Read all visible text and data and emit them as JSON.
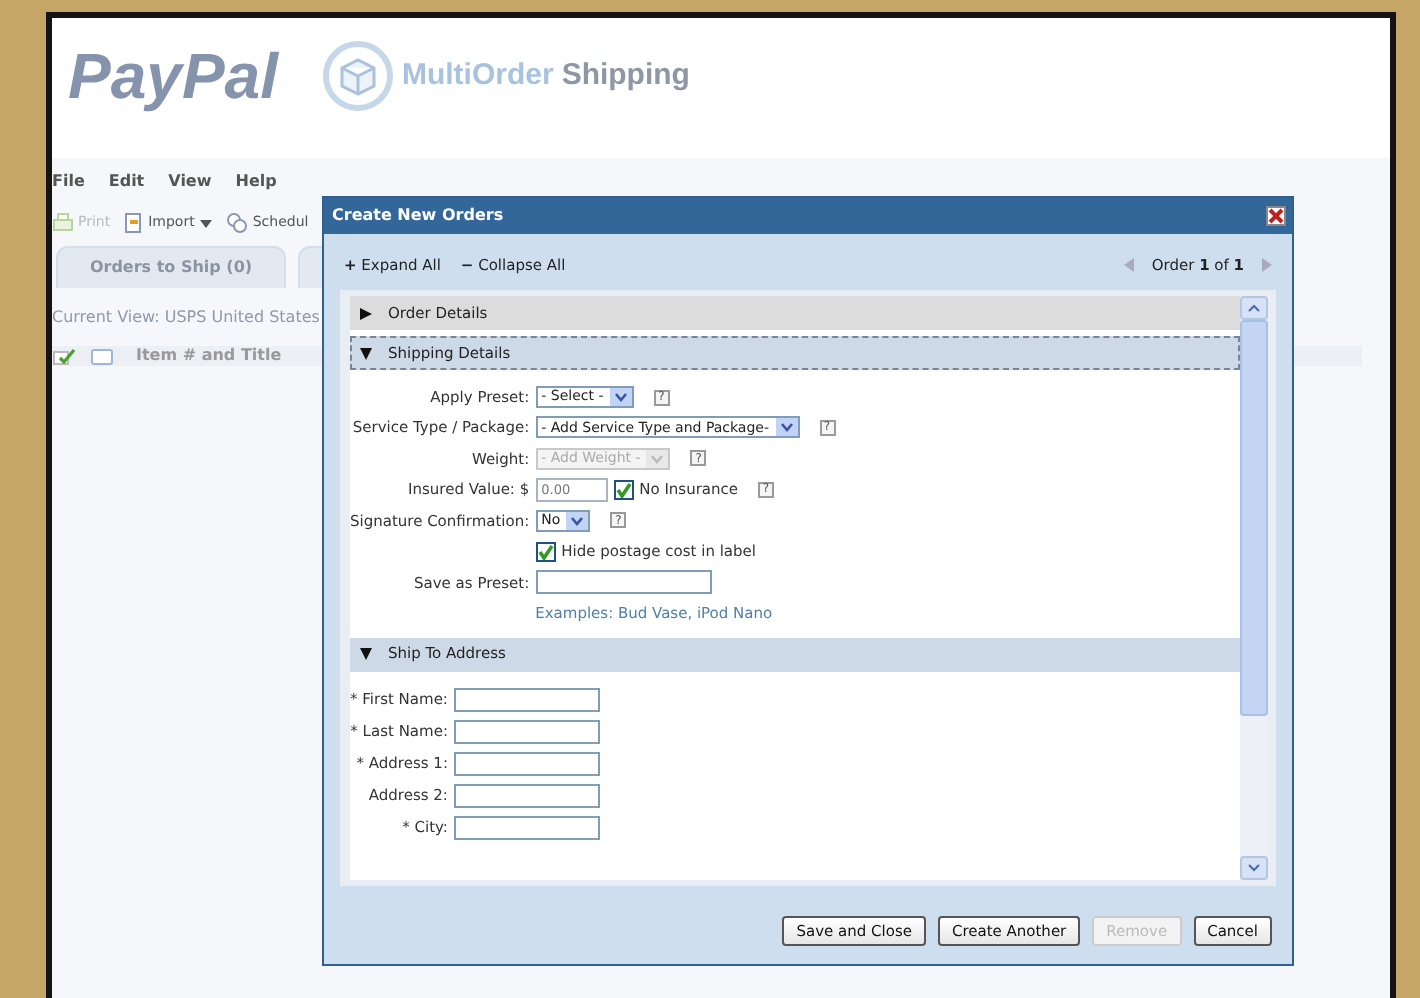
{
  "header": {
    "brand": "PayPal",
    "product_first": "MultiOrder",
    "product_second": "Shipping"
  },
  "menu": [
    "File",
    "Edit",
    "View",
    "Help"
  ],
  "toolbar": [
    {
      "kind": "print",
      "label": "Print",
      "disabled": true,
      "dropdown": false
    },
    {
      "kind": "import",
      "label": "Import",
      "disabled": false,
      "dropdown": true
    },
    {
      "kind": "schedule",
      "label": "Schedul",
      "disabled": false,
      "dropdown": false
    }
  ],
  "tabs": [
    {
      "label": "Orders to Ship (0)",
      "selected": false
    }
  ],
  "current_view": "Current View: USPS United States",
  "columns": [
    "Item # and Title"
  ],
  "dialog": {
    "title": "Create New Orders",
    "expand": {
      "sign": "+",
      "label": "Expand All"
    },
    "collapse": {
      "sign": "−",
      "label": "Collapse All"
    },
    "pager": "Order **1** of **1**",
    "sections": [
      {
        "title": "Order Details",
        "expanded": false,
        "focused": false
      },
      {
        "title": "Shipping Details",
        "expanded": true,
        "focused": true,
        "fields": [
          {
            "kind": "select",
            "label": "Apply Preset:",
            "value": "- Select -",
            "disabled": false,
            "help": "?"
          },
          {
            "kind": "select",
            "label": "Service Type / Package:",
            "value": "- Add Service Type and Package-",
            "disabled": false,
            "help": "?"
          },
          {
            "kind": "select",
            "label": "Weight:",
            "value": "- Add Weight -",
            "disabled": true,
            "help": "?"
          },
          {
            "kind": "insured",
            "label": "Insured Value: $",
            "placeholder": "0.00",
            "disabled": true,
            "check_label": "No Insurance",
            "checked": true,
            "help": "?"
          },
          {
            "kind": "select",
            "label": "Signature Confirmation:",
            "value": "No",
            "disabled": false,
            "help": "?"
          },
          {
            "kind": "checkbox",
            "label": "Hide postage cost in label",
            "checked": true
          },
          {
            "kind": "input",
            "label": "Save as Preset:",
            "hint": "Examples: Bud Vase, iPod Nano"
          }
        ]
      },
      {
        "title": "Ship To Address",
        "expanded": true,
        "focused": false,
        "fields": [
          {
            "kind": "input",
            "label": "* First Name:"
          },
          {
            "kind": "input",
            "label": "* Last Name:"
          },
          {
            "kind": "input",
            "label": "* Address 1:"
          },
          {
            "kind": "input",
            "label": "Address 2:"
          },
          {
            "kind": "input",
            "label": "* City:"
          }
        ]
      }
    ],
    "buttons": [
      {
        "label": "Save and Close",
        "disabled": false
      },
      {
        "label": "Create Another",
        "disabled": false
      },
      {
        "label": "Remove",
        "disabled": true
      },
      {
        "label": "Cancel",
        "disabled": false
      }
    ]
  }
}
